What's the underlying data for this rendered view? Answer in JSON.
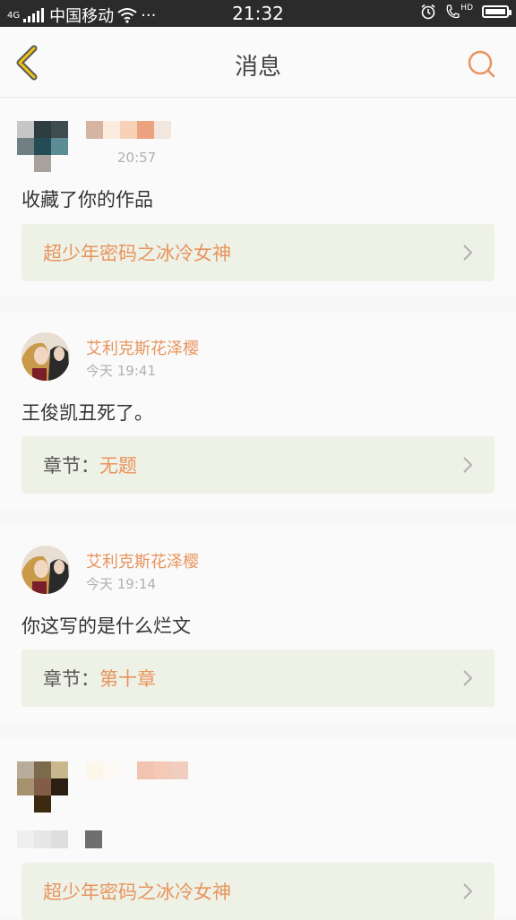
{
  "status_bar": {
    "network": "4G",
    "carrier": "中国移动",
    "more": "···",
    "time": "21:32",
    "hd": "HD"
  },
  "header": {
    "title": "消息"
  },
  "messages": [
    {
      "username": "",
      "time": "20:57",
      "content": "收藏了你的作品",
      "reference_label": "",
      "reference_title": "超少年密码之冰冷女神"
    },
    {
      "username": "艾利克斯花泽樱",
      "time": "今天 19:41",
      "content": "王俊凯丑死了。",
      "reference_label": "章节：",
      "reference_title": "无题"
    },
    {
      "username": "艾利克斯花泽樱",
      "time": "今天 19:14",
      "content": "你这写的是什么烂文",
      "reference_label": "章节：",
      "reference_title": "第十章"
    },
    {
      "username": "",
      "time": "",
      "content": "",
      "reference_label": "",
      "reference_title": "超少年密码之冰冷女神"
    }
  ],
  "colors": {
    "accent": "#e8945d",
    "status_bar": "#2b2b2b",
    "reference_bg": "#eef1e6"
  }
}
